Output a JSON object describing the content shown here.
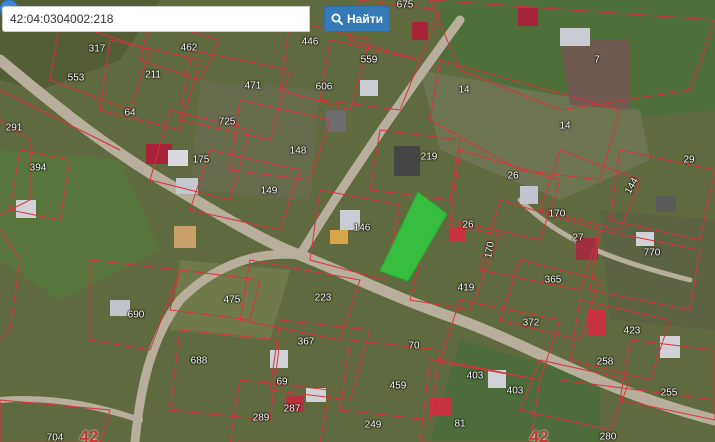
{
  "search": {
    "value": "42:04:0304002:218",
    "button_label": "Найти",
    "button_icon": "search-icon"
  },
  "marker": {
    "icon": "map-pin-icon",
    "color": "#3b86d6"
  },
  "selected_parcel": {
    "id": "218",
    "fill": "#2ecc40"
  },
  "parcel_labels": [
    {
      "text": "675"
    },
    {
      "text": "317"
    },
    {
      "text": "462"
    },
    {
      "text": "446"
    },
    {
      "text": "7"
    },
    {
      "text": "553"
    },
    {
      "text": "211"
    },
    {
      "text": "559"
    },
    {
      "text": "606"
    },
    {
      "text": "471"
    },
    {
      "text": "14"
    },
    {
      "text": "64"
    },
    {
      "text": "725"
    },
    {
      "text": "14"
    },
    {
      "text": "291"
    },
    {
      "text": "148"
    },
    {
      "text": "219"
    },
    {
      "text": "175"
    },
    {
      "text": "394"
    },
    {
      "text": "29"
    },
    {
      "text": "26"
    },
    {
      "text": "149"
    },
    {
      "text": "144"
    },
    {
      "text": "170"
    },
    {
      "text": "146"
    },
    {
      "text": "26"
    },
    {
      "text": "27"
    },
    {
      "text": "170"
    },
    {
      "text": "770"
    },
    {
      "text": "365"
    },
    {
      "text": "419"
    },
    {
      "text": "475"
    },
    {
      "text": "223"
    },
    {
      "text": "690"
    },
    {
      "text": "372"
    },
    {
      "text": "423"
    },
    {
      "text": "367"
    },
    {
      "text": "70"
    },
    {
      "text": "688"
    },
    {
      "text": "258"
    },
    {
      "text": "403"
    },
    {
      "text": "69"
    },
    {
      "text": "459"
    },
    {
      "text": "403"
    },
    {
      "text": "255"
    },
    {
      "text": "289"
    },
    {
      "text": "287"
    },
    {
      "text": "249"
    },
    {
      "text": "81"
    },
    {
      "text": "704"
    },
    {
      "text": "280"
    }
  ],
  "zone_labels": [
    {
      "text": "42"
    },
    {
      "text": "42"
    }
  ],
  "colors": {
    "boundary": "#d9323a",
    "road": "#b7ae9d"
  }
}
